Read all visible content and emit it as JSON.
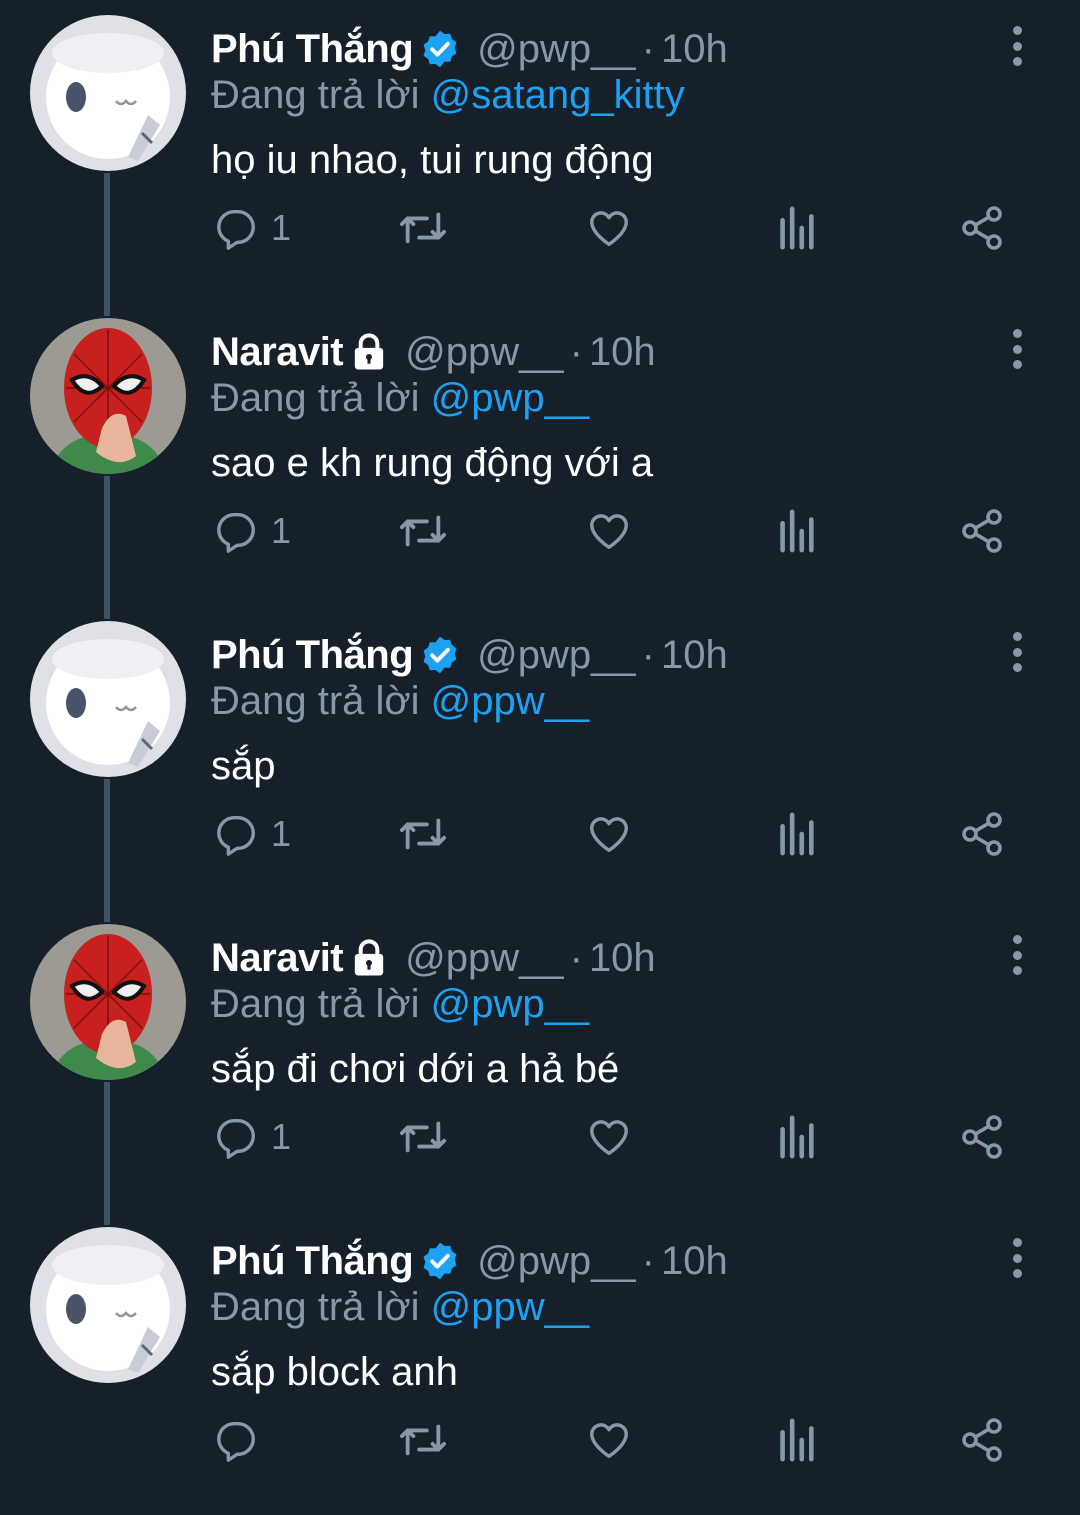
{
  "tweets": [
    {
      "name": "Phú Thắng",
      "verified": true,
      "locked": false,
      "handle": "@pwp__",
      "dot": "·",
      "time": "10h",
      "reply_prefix": "Đang trả lời",
      "reply_to": "@satang_kitty",
      "text": "họ iu nhao, tui rung động",
      "reply_count": "1",
      "avatar": "white-character-avatar"
    },
    {
      "name": "Naravit",
      "verified": false,
      "locked": true,
      "handle": "@ppw__",
      "dot": "·",
      "time": "10h",
      "reply_prefix": "Đang trả lời",
      "reply_to": "@pwp__",
      "text": "sao e kh rung động với a",
      "reply_count": "1",
      "avatar": "spiderman-mask-avatar"
    },
    {
      "name": "Phú Thắng",
      "verified": true,
      "locked": false,
      "handle": "@pwp__",
      "dot": "·",
      "time": "10h",
      "reply_prefix": "Đang trả lời",
      "reply_to": "@ppw__",
      "text": "sắp",
      "reply_count": "1",
      "avatar": "white-character-avatar"
    },
    {
      "name": "Naravit",
      "verified": false,
      "locked": true,
      "handle": "@ppw__",
      "dot": "·",
      "time": "10h",
      "reply_prefix": "Đang trả lời",
      "reply_to": "@pwp__",
      "text": "sắp đi chơi dới a hả bé",
      "reply_count": "1",
      "avatar": "spiderman-mask-avatar"
    },
    {
      "name": "Phú Thắng",
      "verified": true,
      "locked": false,
      "handle": "@pwp__",
      "dot": "·",
      "time": "10h",
      "reply_prefix": "Đang trả lời",
      "reply_to": "@ppw__",
      "text": "sắp block anh",
      "reply_count": "",
      "avatar": "white-character-avatar"
    }
  ],
  "colors": {
    "background": "#15202b",
    "secondary_text": "#8899a6",
    "link": "#1da1f2",
    "thread_line": "#3d5466"
  }
}
